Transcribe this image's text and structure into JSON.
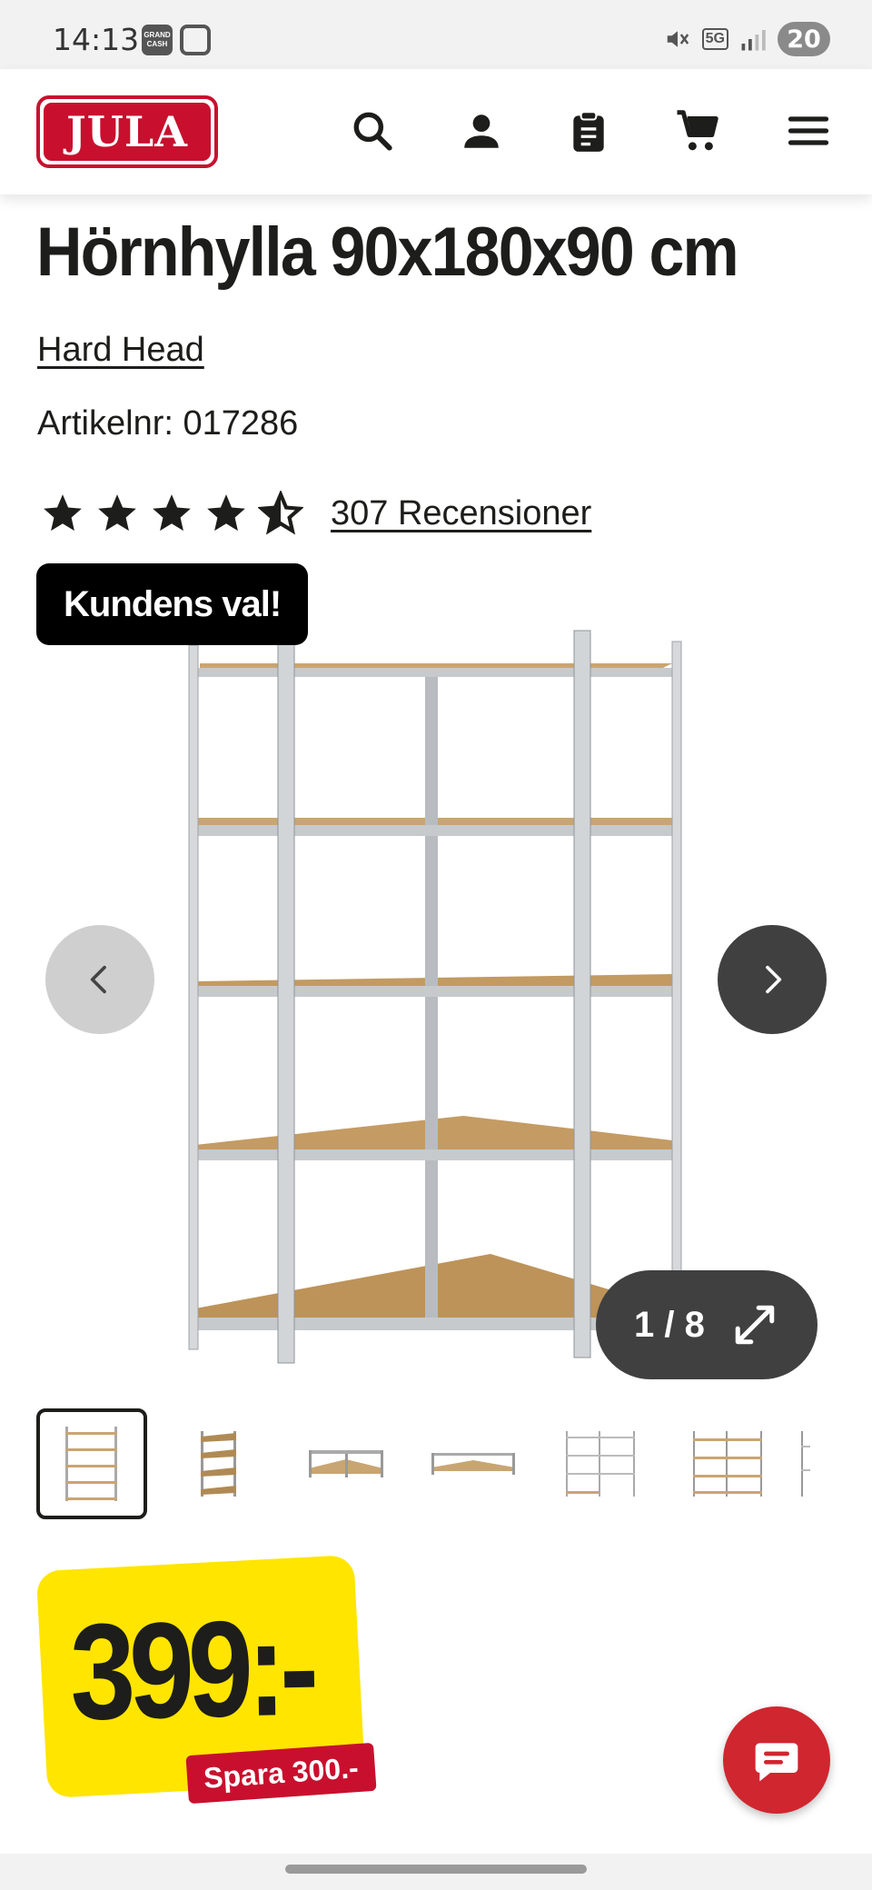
{
  "status_bar": {
    "time": "14:13",
    "grand_cash_label": "GRAND CASH",
    "network": "5G",
    "battery": "20"
  },
  "header": {
    "logo_text": "JULA",
    "icons": [
      "search-icon",
      "account-icon",
      "clipboard-icon",
      "cart-icon",
      "menu-icon"
    ]
  },
  "product": {
    "title": "Hörnhylla 90x180x90 cm",
    "brand": "Hard Head",
    "article_number": "Artikelnr: 017286",
    "rating": {
      "value": 4.5,
      "max": 5
    },
    "reviews_label": "307 Recensioner"
  },
  "gallery": {
    "badge": "Kundens val!",
    "counter": "1 / 8",
    "thumbnail_count_visible": 7
  },
  "price": {
    "amount": "399:-",
    "savings": "Spara 300.-"
  },
  "colors": {
    "brand_red": "#c8102e",
    "price_yellow": "#ffe500",
    "dark_button": "#404040",
    "chat_red": "#d0262f"
  }
}
